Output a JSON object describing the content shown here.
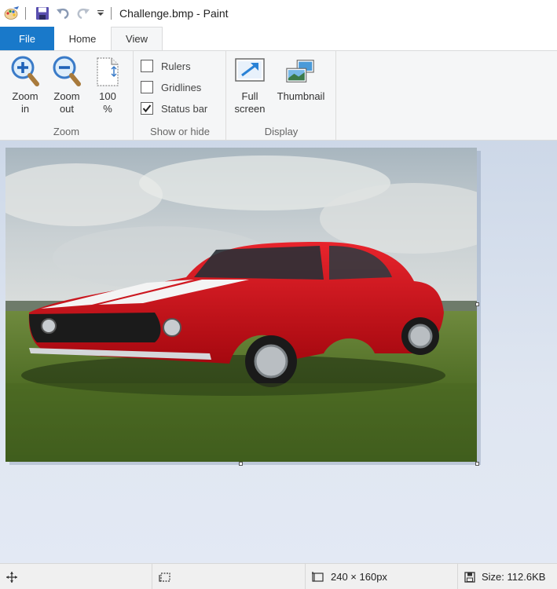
{
  "window": {
    "title": "Challenge.bmp - Paint"
  },
  "tabs": {
    "file": "File",
    "home": "Home",
    "view": "View"
  },
  "ribbon": {
    "zoom": {
      "label": "Zoom",
      "zoom_in": [
        "Zoom",
        "in"
      ],
      "zoom_out": [
        "Zoom",
        "out"
      ],
      "actual": [
        "100",
        "%"
      ]
    },
    "show_hide": {
      "label": "Show or hide",
      "rulers": {
        "label": "Rulers",
        "checked": false
      },
      "gridlines": {
        "label": "Gridlines",
        "checked": false
      },
      "status_bar": {
        "label": "Status bar",
        "checked": true
      }
    },
    "display": {
      "label": "Display",
      "full_screen": [
        "Full",
        "screen"
      ],
      "thumbnail": "Thumbnail"
    }
  },
  "status": {
    "dimensions": "240 × 160px",
    "size": "Size: 112.6KB"
  },
  "colors": {
    "file_tab": "#1979ca",
    "car_red": "#d3141c"
  }
}
